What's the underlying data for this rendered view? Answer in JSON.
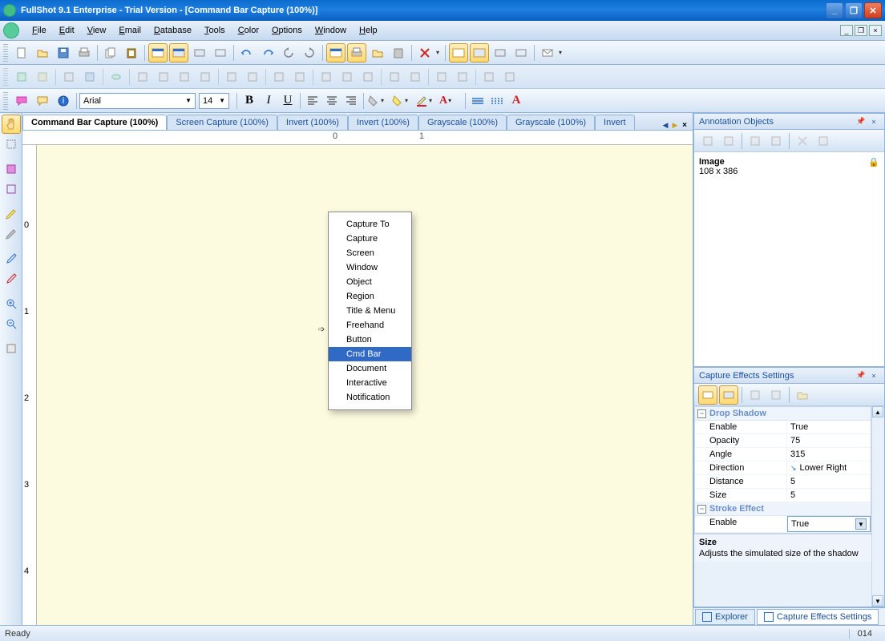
{
  "titlebar": {
    "text": "FullShot 9.1 Enterprise - Trial Version - [Command Bar Capture (100%)]"
  },
  "menus": [
    "File",
    "Edit",
    "View",
    "Email",
    "Database",
    "Tools",
    "Color",
    "Options",
    "Window",
    "Help"
  ],
  "format": {
    "font": "Arial",
    "size": "14"
  },
  "tabs": [
    {
      "label": "Command Bar Capture (100%)",
      "active": true
    },
    {
      "label": "Screen Capture (100%)",
      "active": false
    },
    {
      "label": "Invert (100%)",
      "active": false
    },
    {
      "label": "Invert (100%)",
      "active": false
    },
    {
      "label": "Grayscale (100%)",
      "active": false
    },
    {
      "label": "Grayscale (100%)",
      "active": false
    },
    {
      "label": "Invert",
      "active": false
    }
  ],
  "capture_menu": {
    "items": [
      "Capture To",
      "Capture",
      "Screen",
      "Window",
      "Object",
      "Region",
      "Title & Menu",
      "Freehand",
      "Button",
      "Cmd Bar",
      "Document",
      "Interactive",
      "Notification"
    ],
    "selected_index": 9
  },
  "annotation_panel": {
    "title": "Annotation Objects",
    "obj_label": "Image",
    "obj_dims": "108 x 386"
  },
  "effects_panel": {
    "title": "Capture Effects Settings",
    "cat1": "Drop Shadow",
    "cat2": "Stroke Effect",
    "rows_shadow": [
      {
        "name": "Enable",
        "val": "True"
      },
      {
        "name": "Opacity",
        "val": "75"
      },
      {
        "name": "Angle",
        "val": "315"
      },
      {
        "name": "Direction",
        "val": "Lower Right",
        "icon": true
      },
      {
        "name": "Distance",
        "val": "5"
      },
      {
        "name": "Size",
        "val": "5"
      }
    ],
    "rows_stroke": [
      {
        "name": "Enable",
        "val": "True",
        "selected": true
      }
    ],
    "desc_title": "Size",
    "desc_text": "Adjusts the simulated size of the shadow"
  },
  "bottom_tabs": [
    {
      "label": "Explorer",
      "active": false
    },
    {
      "label": "Capture Effects Settings",
      "active": true
    }
  ],
  "statusbar": {
    "ready": "Ready",
    "num": "014"
  }
}
